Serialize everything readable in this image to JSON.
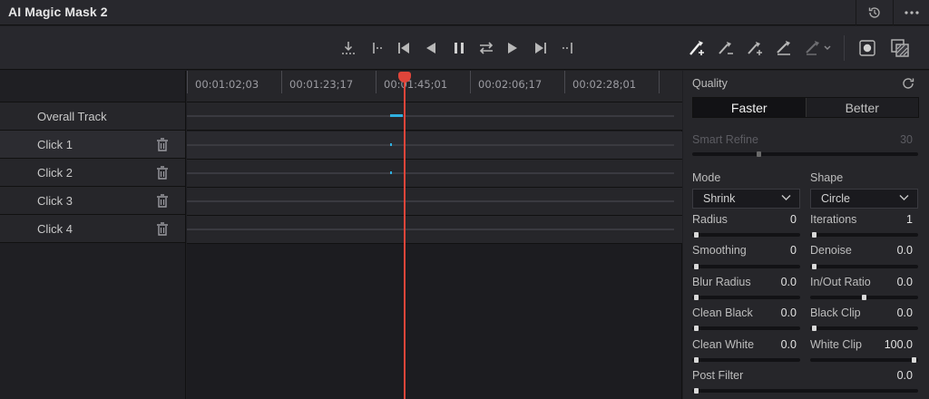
{
  "window": {
    "title": "AI Magic Mask 2"
  },
  "tracks": {
    "items": [
      {
        "label": "Overall Track"
      },
      {
        "label": "Click 1"
      },
      {
        "label": "Click 2"
      },
      {
        "label": "Click 3"
      },
      {
        "label": "Click 4"
      }
    ]
  },
  "timeline": {
    "timecodes": [
      "00:01:02;03",
      "00:01:23;17",
      "00:01:45;01",
      "00:02:06;17",
      "00:02:28;01"
    ]
  },
  "panel": {
    "quality_label": "Quality",
    "quality_options": [
      "Faster",
      "Better"
    ],
    "quality_selected": "Faster",
    "smart_refine_label": "Smart Refine",
    "smart_refine_value": "30",
    "mode_label": "Mode",
    "mode_value": "Shrink",
    "shape_label": "Shape",
    "shape_value": "Circle",
    "params": [
      {
        "label": "Radius",
        "value": "0"
      },
      {
        "label": "Iterations",
        "value": "1"
      },
      {
        "label": "Smoothing",
        "value": "0"
      },
      {
        "label": "Denoise",
        "value": "0.0"
      },
      {
        "label": "Blur Radius",
        "value": "0.0"
      },
      {
        "label": "In/Out Ratio",
        "value": "0.0"
      },
      {
        "label": "Clean Black",
        "value": "0.0"
      },
      {
        "label": "Black Clip",
        "value": "0.0"
      },
      {
        "label": "Clean White",
        "value": "0.0"
      },
      {
        "label": "White Clip",
        "value": "100.0"
      }
    ],
    "post_filter_label": "Post Filter",
    "post_filter_value": "0.0"
  },
  "icons": {
    "toolbar": [
      "track-in-icon",
      "step-back-icon",
      "go-start-icon",
      "track-backward-icon",
      "pause-icon",
      "track-both-icon",
      "track-forward-icon",
      "go-end-icon",
      "step-forward-icon",
      "add-stroke-icon",
      "subtract-stroke-icon",
      "add-feature-icon",
      "remove-stroke-icon",
      "eraser-icon",
      "mask-overlay-icon",
      "matte-view-icon"
    ],
    "header": [
      "history-icon",
      "more-options-icon"
    ]
  },
  "colors": {
    "playhead": "#e0453a",
    "track_marker": "#2fb0e0",
    "background": "#1e1e22"
  }
}
